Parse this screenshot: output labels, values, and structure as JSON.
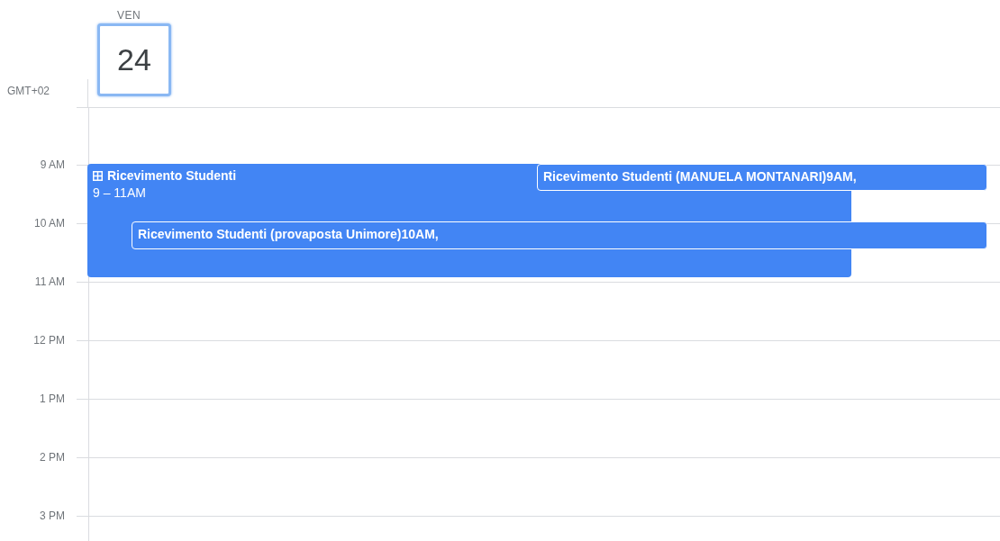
{
  "day": {
    "weekday": "VEN",
    "date": "24",
    "selected": true
  },
  "timezone": "GMT+02",
  "hours": [
    "9 AM",
    "10 AM",
    "11 AM",
    "12 PM",
    "1 PM",
    "2 PM",
    "3 PM"
  ],
  "events": [
    {
      "kind": "block",
      "title": "Ricevimento Studenti",
      "time": "9 – 11AM"
    },
    {
      "kind": "chip",
      "title": "Ricevimento Studenti (MANUELA MONTANARI)9AM,"
    },
    {
      "kind": "chip",
      "title": "Ricevimento Studenti (provaposta Unimore)10AM,"
    }
  ]
}
